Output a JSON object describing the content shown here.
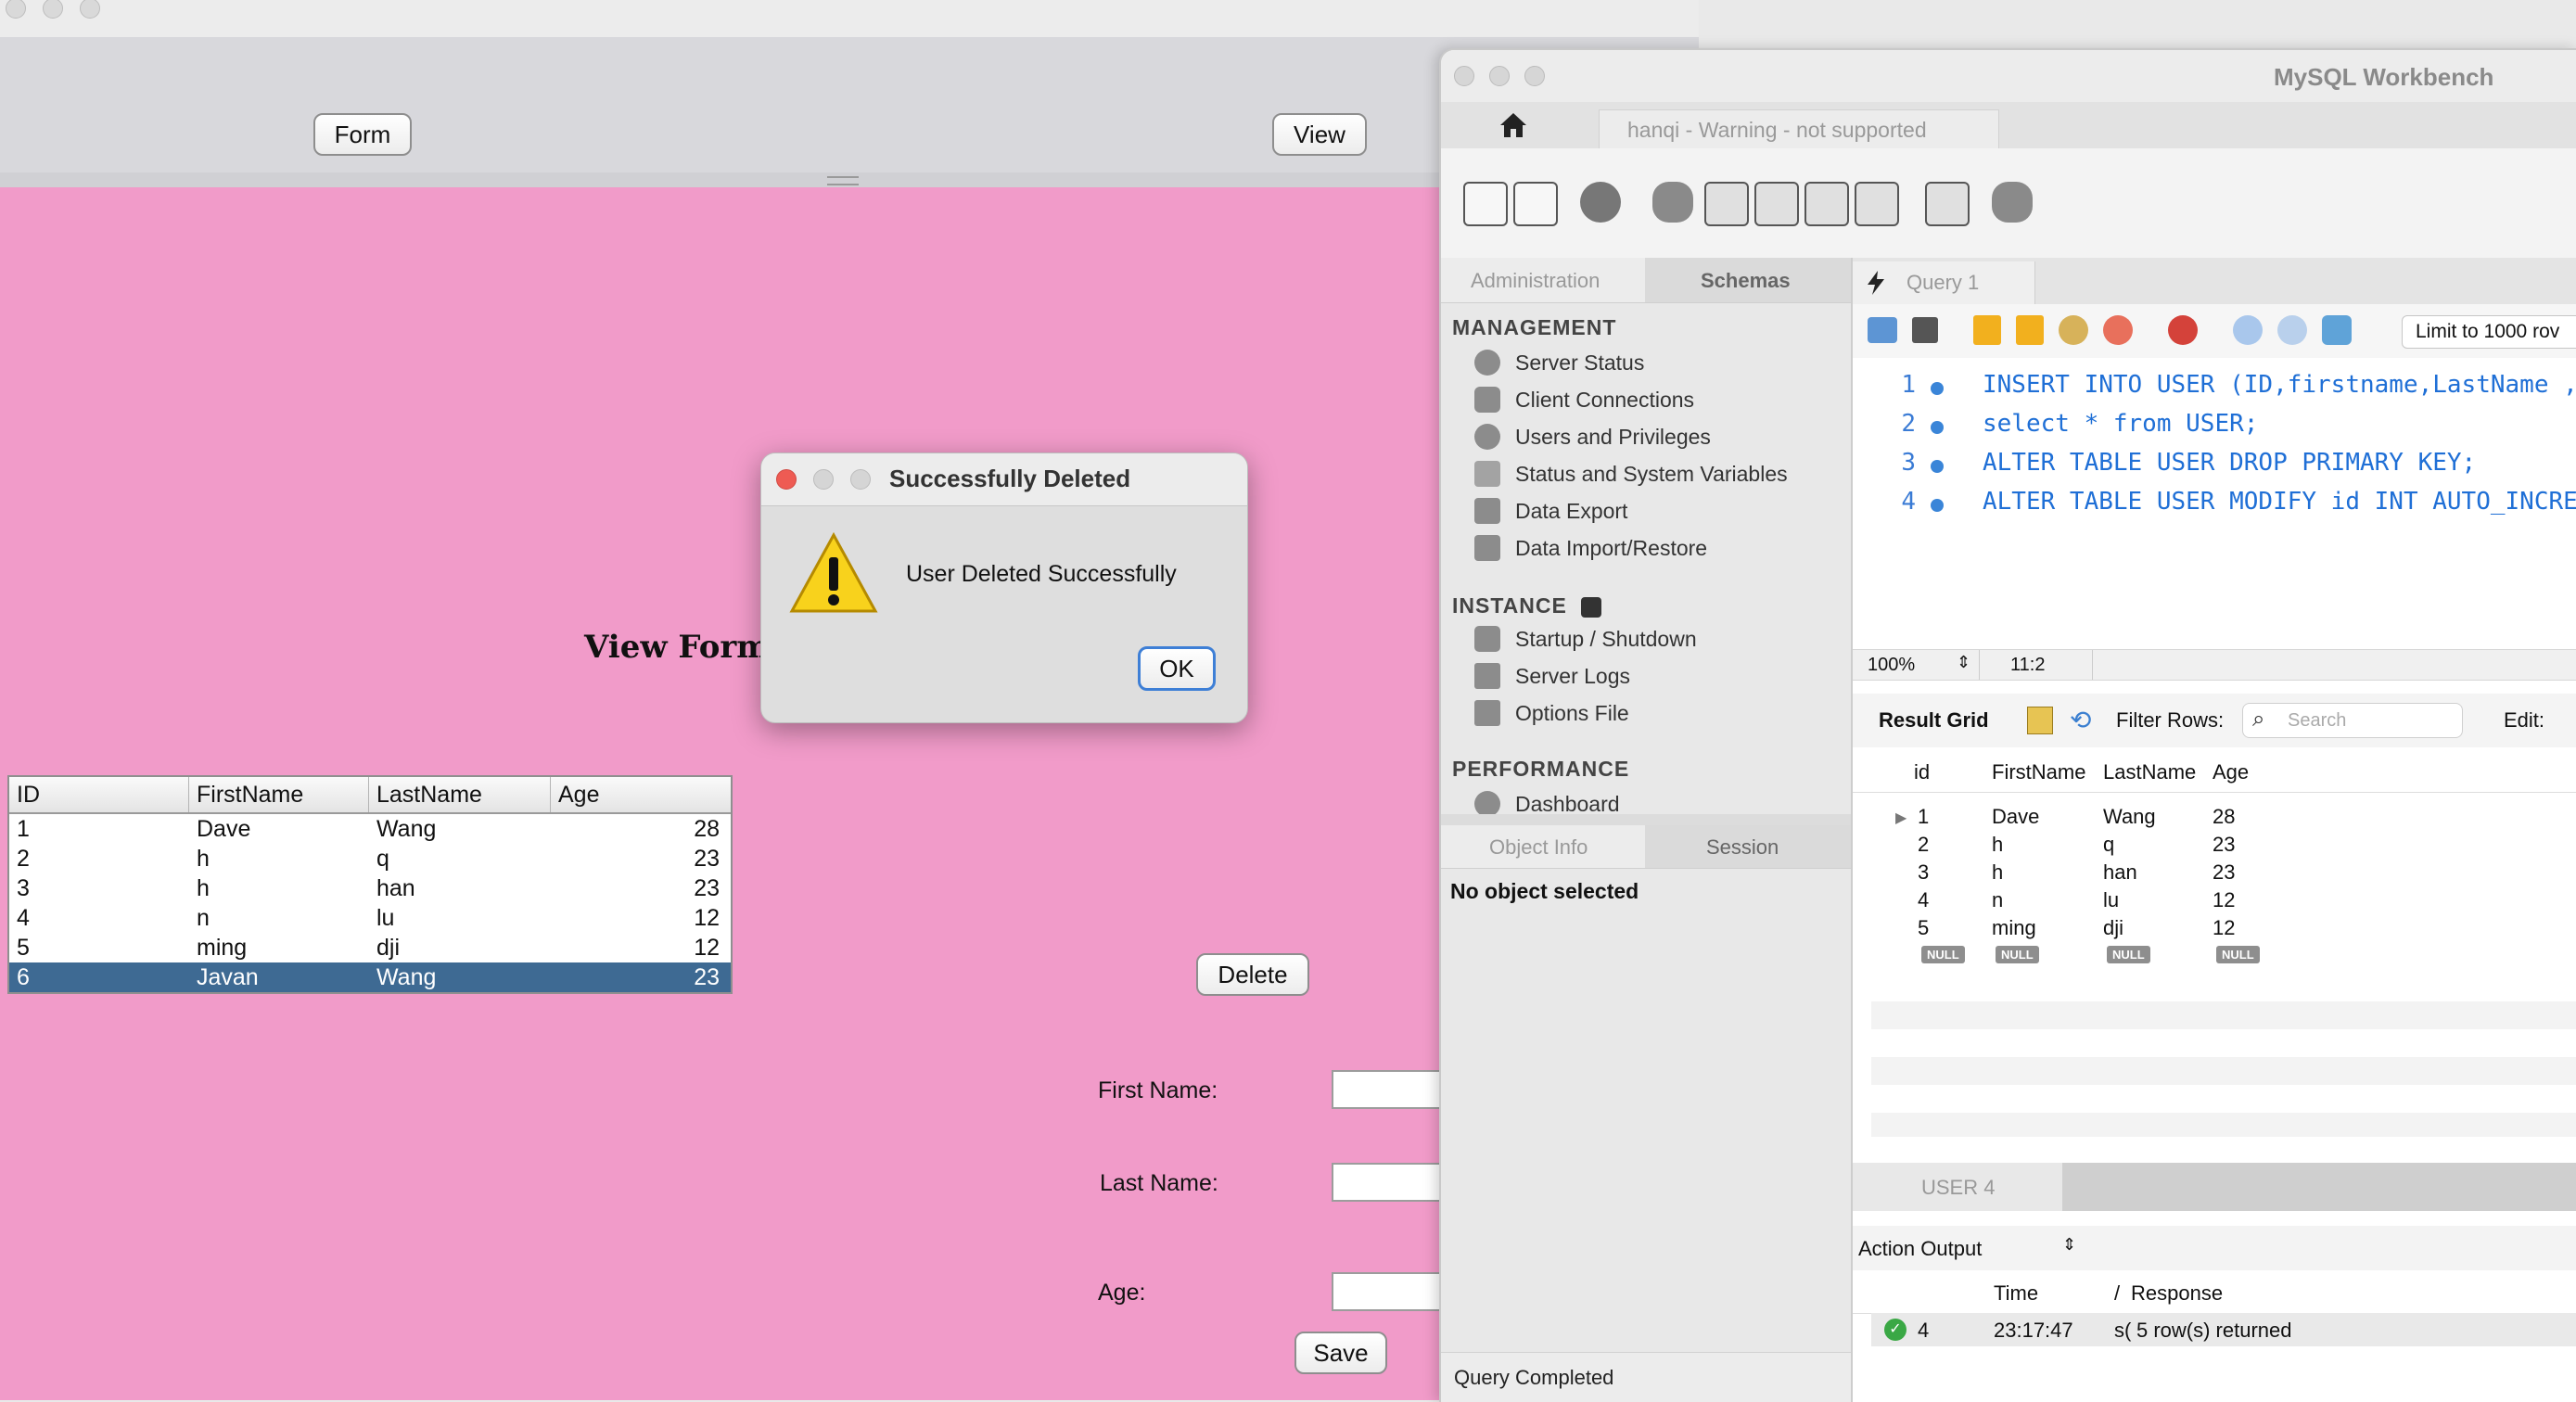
{
  "java_window": {
    "form_button": "Form",
    "view_button": "View",
    "view_form_title": "View Form",
    "table": {
      "columns": [
        "ID",
        "FirstName",
        "LastName",
        "Age"
      ],
      "rows": [
        [
          "1",
          "Dave",
          "Wang",
          "28"
        ],
        [
          "2",
          "h",
          "q",
          "23"
        ],
        [
          "3",
          "h",
          "han",
          "23"
        ],
        [
          "4",
          "n",
          "lu",
          "12"
        ],
        [
          "5",
          "ming",
          "dji",
          "12"
        ],
        [
          "6",
          "Javan",
          "Wang",
          "23"
        ]
      ],
      "selected_row": 6
    },
    "delete_button": "Delete",
    "first_name_label": "First Name:",
    "last_name_label": "Last Name:",
    "age_label": "Age:",
    "save_button": "Save"
  },
  "dialog": {
    "title": "Successfully Deleted",
    "message": "User Deleted Successfully",
    "ok_button": "OK"
  },
  "workbench": {
    "app_title": "MySQL Workbench",
    "connection_tab": "hanqi - Warning - not supported",
    "sidebar_tabs": [
      "Administration",
      "Schemas"
    ],
    "management_heading": "MANAGEMENT",
    "management_items": [
      "Server Status",
      "Client Connections",
      "Users and Privileges",
      "Status and System Variables",
      "Data Export",
      "Data Import/Restore"
    ],
    "instance_heading": "INSTANCE",
    "instance_items": [
      "Startup / Shutdown",
      "Server Logs",
      "Options File"
    ],
    "performance_heading": "PERFORMANCE",
    "performance_items": [
      "Dashboard"
    ],
    "info_tabs": [
      "Object Info",
      "Session"
    ],
    "no_object": "No object selected",
    "query_tab": "Query 1",
    "limit_label": "Limit to 1000 rov",
    "sql_lines": [
      {
        "n": "1",
        "text": "INSERT INTO USER (ID,firstname,LastName ,"
      },
      {
        "n": "2",
        "text": "select * from USER;"
      },
      {
        "n": "3",
        "text": "ALTER TABLE USER DROP PRIMARY KEY;"
      },
      {
        "n": "4",
        "text": "ALTER TABLE USER MODIFY id INT AUTO_INCRE"
      }
    ],
    "zoom": "100%",
    "cursor_pos": "11:2",
    "result_grid_label": "Result Grid",
    "filter_rows_label": "Filter Rows:",
    "search_placeholder": "Search",
    "edit_label": "Edit:",
    "grid_columns": [
      "id",
      "FirstName",
      "LastName",
      "Age"
    ],
    "grid_rows": [
      [
        "1",
        "Dave",
        "Wang",
        "28"
      ],
      [
        "2",
        "h",
        "q",
        "23"
      ],
      [
        "3",
        "h",
        "han",
        "23"
      ],
      [
        "4",
        "n",
        "lu",
        "12"
      ],
      [
        "5",
        "ming",
        "dji",
        "12"
      ]
    ],
    "null_label": "NULL",
    "result_tab": "USER 4",
    "action_output_label": "Action Output",
    "output_columns": [
      "Time",
      "/",
      "Response"
    ],
    "output_row": {
      "n": "4",
      "time": "23:17:47",
      "action": "s(",
      "response": "5 row(s) returned"
    },
    "status_text": "Query Completed"
  }
}
